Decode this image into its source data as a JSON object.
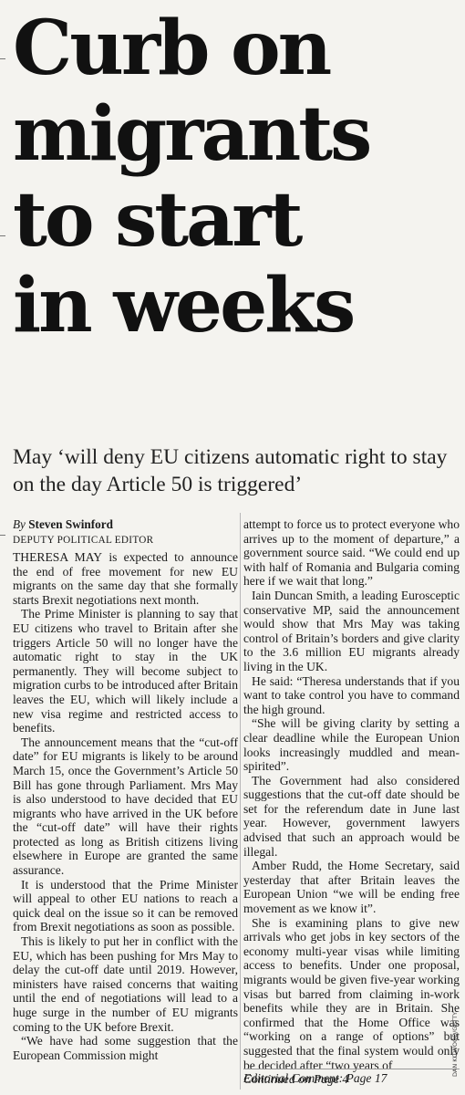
{
  "headline": {
    "lines": [
      "Curb on",
      "migrants",
      "to start",
      "in weeks"
    ]
  },
  "deck": "May ‘will deny EU citizens automatic right to stay on the day Article 50 is triggered’",
  "byline": {
    "by": "By",
    "author": "Steven Swinford",
    "role": "DEPUTY POLITICAL EDITOR"
  },
  "article": {
    "lead_caps": "THERESA MAY",
    "lead_rest": " is expected to announce the end of free movement for new EU migrants on the same day that she formally starts Brexit negotiations next month.",
    "col1": [
      "The Prime Minister is planning to say that EU citizens who travel to Britain after she triggers Article 50 will no longer have the automatic right to stay in the UK permanently. They will become subject to migration curbs to be introduced after Britain leaves the EU, which will likely include a new visa regime and restricted access to benefits.",
      "The announcement means that the “cut-off date” for EU migrants is likely to be around March 15, once the Government’s Article 50 Bill has gone through Parliament. Mrs May is also understood to have decided that EU migrants who have arrived in the UK before the “cut-off date” will have their rights protected as long as British citizens living elsewhere in Europe are granted the same assurance.",
      "It is understood that the Prime Minister will appeal to other EU nations to reach a quick deal on the issue so it can be removed from Brexit negotiations as soon as possible.",
      "This is likely to put her in conflict with the EU, which has been pushing for Mrs May to delay the cut-off date until 2019. However, ministers have raised concerns that waiting until the end of negotiations will lead to a huge surge in the number of EU migrants coming to the UK before Brexit.",
      "“We have had some suggestion that the European Commission might"
    ],
    "col2_start": "attempt to force us to protect everyone who arrives up to the moment of departure,” a government source said. “We could end up with half of Romania and Bulgaria coming here if we wait that long.”",
    "col2": [
      "Iain Duncan Smith, a leading Eurosceptic conservative MP, said the announcement would show that Mrs May was taking control of Britain’s borders and give clarity to the 3.6 million EU migrants already living in the UK.",
      "He said: “Theresa understands that if you want to take control you have to command the high ground.",
      "“She will be giving clarity by setting a clear deadline while the European Union looks increasingly muddled and mean-spirited”.",
      "The Government had also considered suggestions that the cut-off date should be set for the referendum date in June last year. However, government lawyers advised that such an approach would be illegal.",
      "Amber Rudd, the Home Secretary, said yesterday that after Britain leaves the European Union “we will be ending free movement as we know it”.",
      "She is examining plans to give new arrivals who get jobs in key sectors of the economy multi-year visas while limiting access to benefits. Under one proposal, migrants would be given five-year working visas but barred from claiming in-work benefits while they are in Britain. She confirmed that the Home Office was “working on a range of options” but suggested that the final system would only be decided after “two years of"
    ],
    "continued": "Continued on Page 4"
  },
  "footer": "Editorial Comment: Page 17",
  "photo_credit": "DAN KITWOOD/GETTY"
}
